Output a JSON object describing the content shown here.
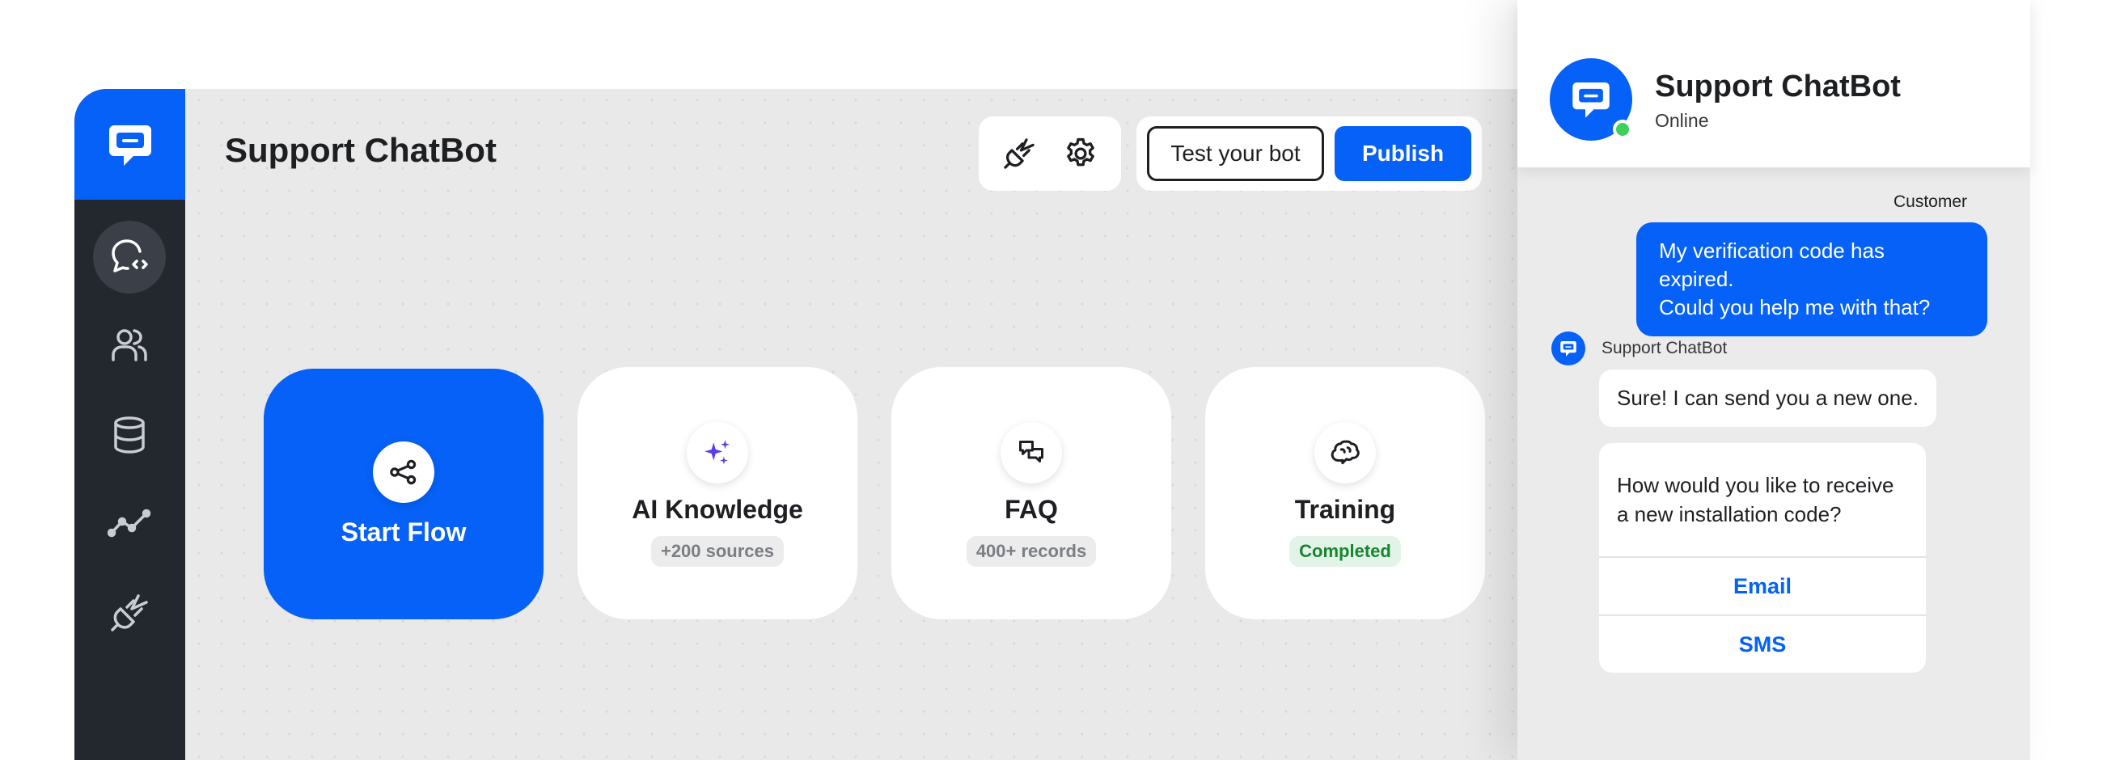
{
  "app": {
    "title": "Support ChatBot",
    "toolbar": {
      "integrations_icon": "plug-icon",
      "settings_icon": "gear-icon",
      "test_label": "Test your bot",
      "publish_label": "Publish"
    },
    "sidebar": {
      "logo_icon": "chatbot-logo-icon",
      "items": [
        {
          "name": "chatbot-flows",
          "icon": "chat-code-icon",
          "active": true
        },
        {
          "name": "users",
          "icon": "users-icon",
          "active": false
        },
        {
          "name": "data",
          "icon": "database-icon",
          "active": false
        },
        {
          "name": "reports",
          "icon": "line-chart-icon",
          "active": false
        },
        {
          "name": "integrations",
          "icon": "plug-icon",
          "active": false
        }
      ]
    },
    "cards": [
      {
        "title": "Start Flow",
        "icon": "share-nodes-icon"
      },
      {
        "title": "AI Knowledge",
        "badge": "+200 sources",
        "icon": "sparkles-icon"
      },
      {
        "title": "FAQ",
        "badge": "400+ records",
        "icon": "chat-bubbles-icon"
      },
      {
        "title": "Training",
        "badge": "Completed",
        "icon": "brain-icon"
      }
    ]
  },
  "chat": {
    "header": {
      "name": "Support ChatBot",
      "status": "Online"
    },
    "customer_label": "Customer",
    "customer_message_line1": "My verification code has expired.",
    "customer_message_line2": "Could you help me with that?",
    "bot_label": "Support ChatBot",
    "bot_message": "Sure! I can send you a new one.",
    "bot_question_line1": "How would you like to receive",
    "bot_question_line2": "a new installation code?",
    "options": [
      "Email",
      "SMS"
    ]
  },
  "colors": {
    "accent": "#0561f7",
    "sidebar": "#23272e",
    "canvas": "#e9e9e9",
    "success": "#19852f",
    "online": "#3fcf5b"
  }
}
